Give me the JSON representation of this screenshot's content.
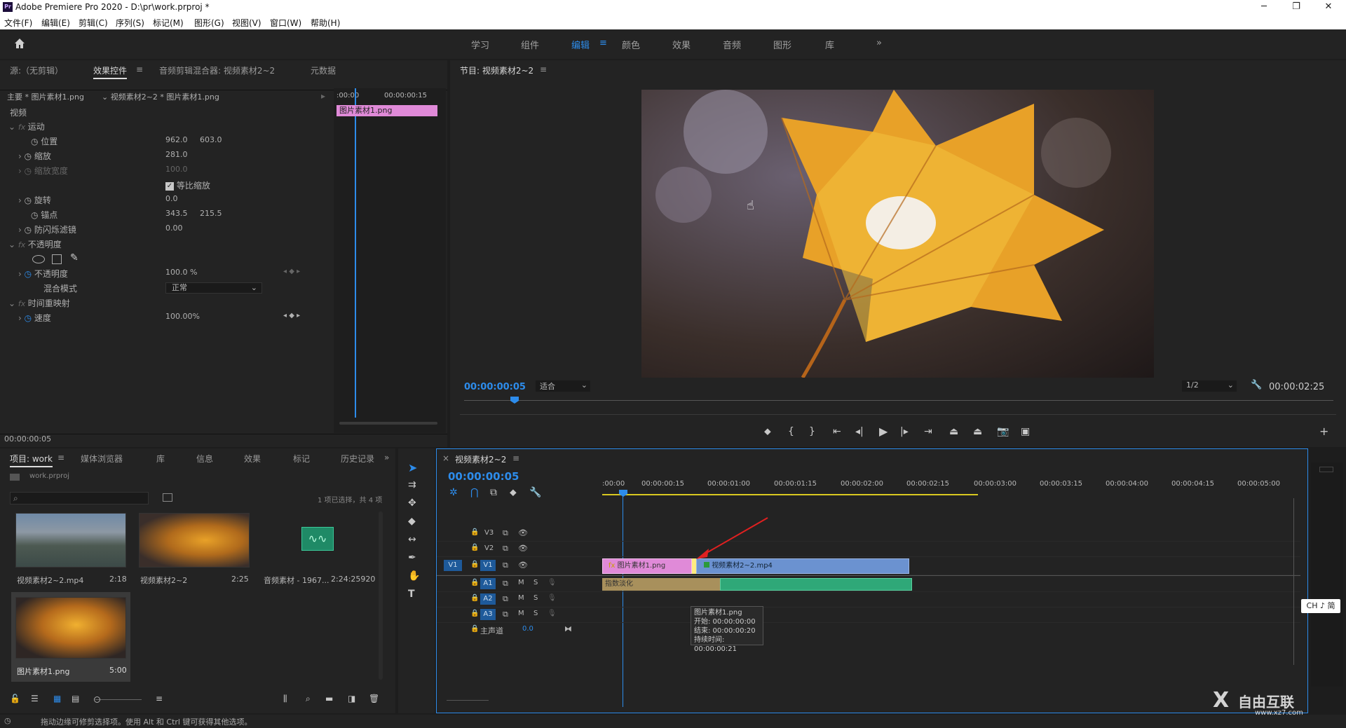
{
  "window": {
    "title": "Adobe Premiere Pro 2020 - D:\\pr\\work.prproj *",
    "app_icon": "Pr"
  },
  "menu": [
    "文件(F)",
    "编辑(E)",
    "剪辑(C)",
    "序列(S)",
    "标记(M)",
    "图形(G)",
    "视图(V)",
    "窗口(W)",
    "帮助(H)"
  ],
  "workspaces": {
    "items": [
      "学习",
      "组件",
      "编辑",
      "颜色",
      "效果",
      "音频",
      "图形",
      "库"
    ],
    "active": "编辑",
    "more": "»",
    "menu_icon": "≡"
  },
  "effect_panel": {
    "tabs": [
      "源:（无剪辑）",
      "效果控件",
      "音频剪辑混合器: 视频素材2~2",
      "元数据"
    ],
    "menu_icon": "≡",
    "master": "主要 * 图片素材1.png",
    "clip": "视频素材2~2 * 图片素材1.png",
    "tc_start": ":00:00",
    "tc_end": "00:00:00:15",
    "clip_block": "图片素材1.png",
    "section_video": "视频",
    "motion": "运动",
    "position_label": "位置",
    "position_x": "962.0",
    "position_y": "603.0",
    "scale_label": "缩放",
    "scale_val": "281.0",
    "scale_width_label": "缩放宽度",
    "scale_width_val": "100.0",
    "uniform_label": "等比缩放",
    "rotation_label": "旋转",
    "rotation_val": "0.0",
    "anchor_label": "锚点",
    "anchor_x": "343.5",
    "anchor_y": "215.5",
    "flicker_label": "防闪烁滤镜",
    "flicker_val": "0.00",
    "opacity": "不透明度",
    "opacity_label": "不透明度",
    "opacity_val": "100.0 %",
    "blend_label": "混合模式",
    "blend_val": "正常",
    "time_remap": "时间重映射",
    "speed_label": "速度",
    "speed_val": "100.00%",
    "timecode": "00:00:00:05"
  },
  "program_monitor": {
    "title": "节目: 视频素材2~2",
    "menu_icon": "≡",
    "timecode": "00:00:00:05",
    "fit": "适合",
    "resolution": "1/2",
    "duration": "00:00:02:25"
  },
  "project_panel": {
    "tabs": [
      "项目: work",
      "媒体浏览器",
      "库",
      "信息",
      "效果",
      "标记",
      "历史记录"
    ],
    "menu_icon": "≡",
    "more": "»",
    "file": "work.prproj",
    "status": "1 项已选择，共 4 项",
    "items": [
      {
        "name": "视频素材2~2.mp4",
        "dur": "2:18"
      },
      {
        "name": "视频素材2~2",
        "dur": "2:25"
      },
      {
        "name": "音频素材 - 1967...",
        "dur": "2:24:25920"
      },
      {
        "name": "图片素材1.png",
        "dur": "5:00"
      }
    ]
  },
  "timeline": {
    "title": "视频素材2~2",
    "close_icon": "×",
    "menu_icon": "≡",
    "timecode": "00:00:00:05",
    "ruler": [
      ":00:00",
      "00:00:00:15",
      "00:00:01:00",
      "00:00:01:15",
      "00:00:02:00",
      "00:00:02:15",
      "00:00:03:00",
      "00:00:03:15",
      "00:00:04:00",
      "00:00:04:15",
      "00:00:05:00"
    ],
    "tracks": [
      "V3",
      "V2",
      "V1",
      "A1",
      "A2",
      "A3"
    ],
    "source_patch": "V1",
    "m": "M",
    "s": "S",
    "master": "主声道",
    "master_val": "0.0",
    "clip_image": "图片素材1.png",
    "clip_video": "视频素材2~2.mp4",
    "clip_audio": "指数淡化",
    "fx_badge": "fx",
    "tooltip": {
      "name": "图片素材1.png",
      "start": "开始: 00:00:00:00",
      "end": "结束: 00:00:00:20",
      "dur": "持续时间: 00:00:00:21"
    }
  },
  "ime": "CH ♪ 简",
  "status_text": "拖动边缘可修剪选择项。使用 Alt 和 Ctrl 键可获得其他选项。",
  "watermark": "自由互联",
  "watermark_url": "www.xz7.com",
  "colors": {
    "accent": "#2d8ceb",
    "clip_pink": "#e08ad8",
    "clip_video": "#6b92d0",
    "audio_green": "#2fa878"
  }
}
